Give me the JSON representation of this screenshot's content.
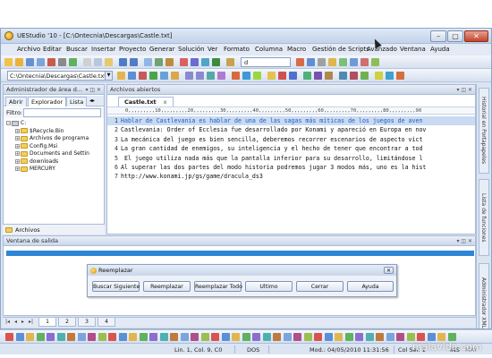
{
  "window": {
    "title": "UEStudio '10 - [C:\\Ontecnia\\Descargas\\Castle.txt]",
    "controls": {
      "minimize": "–",
      "maximize": "▢",
      "close": "✕"
    }
  },
  "menu": [
    "Archivo",
    "Editar",
    "Buscar",
    "Insertar",
    "Proyecto",
    "Generar",
    "Solución",
    "Ver",
    "Formato",
    "Columna",
    "Macro",
    "Gestión de Scripts",
    "Avanzado",
    "Ventana",
    "Ayuda"
  ],
  "toolbar": {
    "path_value": "C:\\Ontecnia\\Descargas\\Castle.txt",
    "find_value": "d"
  },
  "left_panel": {
    "title": "Administrador de área d...",
    "tabs": [
      "Abrir",
      "Explorador",
      "Lista"
    ],
    "filter_label": "Filtro:",
    "tree": [
      {
        "label": "C:",
        "kind": "drive",
        "indent": 0
      },
      {
        "label": "$Recycle.Bin",
        "kind": "folder",
        "indent": 1
      },
      {
        "label": "Archivos de programa",
        "kind": "folder",
        "indent": 1
      },
      {
        "label": "Config.Msi",
        "kind": "folder",
        "indent": 1
      },
      {
        "label": "Documents and Settin",
        "kind": "folder",
        "indent": 1
      },
      {
        "label": "downloads",
        "kind": "folder",
        "indent": 1
      },
      {
        "label": "MERCURY",
        "kind": "folder",
        "indent": 1
      }
    ],
    "bottom_tab": "Archivos"
  },
  "editor": {
    "panel_title": "Archivos abiertos",
    "tab_label": "Castle.txt",
    "tab_close": "x",
    "ruler": "0,,,,,,,,,10,,,,,,,,,20,,,,,,,,,30,,,,,,,,,40,,,,,,,,,50,,,,,,,,,60,,,,,,,,,70,,,,,,,,,80,,,,,,,,,90",
    "lines": [
      {
        "n": "1",
        "text": "Hablar de Castlevania es hablar de una de las sagas más míticas de los juegos de aven"
      },
      {
        "n": "2",
        "text": "Castlevania: Order of Ecclesia fue desarrollado por Konami y apareció en Europa en nov"
      },
      {
        "n": "3",
        "text": "La mecánica del juego es bien sencilla, deberemos recorrer escenarios de aspecto vict"
      },
      {
        "n": "4",
        "text": "La gran cantidad de enemigos, su inteligencia y el hecho de tener que encontrar a tod"
      },
      {
        "n": "5",
        "text": " El juego utiliza nada más que la pantalla inferior para su desarrollo, limitándose l"
      },
      {
        "n": "6",
        "text": "Al superar las dos partes del modo historia podremos jugar 3 modos más, uno es la hist"
      },
      {
        "n": "7",
        "text": "http://www.konami.jp/gs/game/dracula_ds3"
      }
    ]
  },
  "right_tabs": [
    "Historial en Portapapeles",
    "Lista de funciones",
    "Administrador XML"
  ],
  "output": {
    "title": "Ventana de salida"
  },
  "dialog": {
    "title": "Reemplazar",
    "close": "✕",
    "buttons": [
      "Buscar Siguiente",
      "Reemplazar",
      "Reemplazar Todo",
      "Ultimo",
      "Cerrar",
      "Ayuda"
    ]
  },
  "sheet_tabs": [
    "1",
    "2",
    "3",
    "4"
  ],
  "status": {
    "position": "Lin. 1, Col. 9, C0",
    "format": "DOS",
    "modified": "Mod.: 04/05/2010 11:31:56",
    "selection": "Col Sel: 1",
    "ins": "INS",
    "may": "MAY"
  },
  "watermark": "malavida.com",
  "colors": {
    "chrome": "#dbe4f1",
    "selection_line": "#c9daf2",
    "link_text": "#1f5fbf",
    "output_bar": "#2e86d6"
  }
}
